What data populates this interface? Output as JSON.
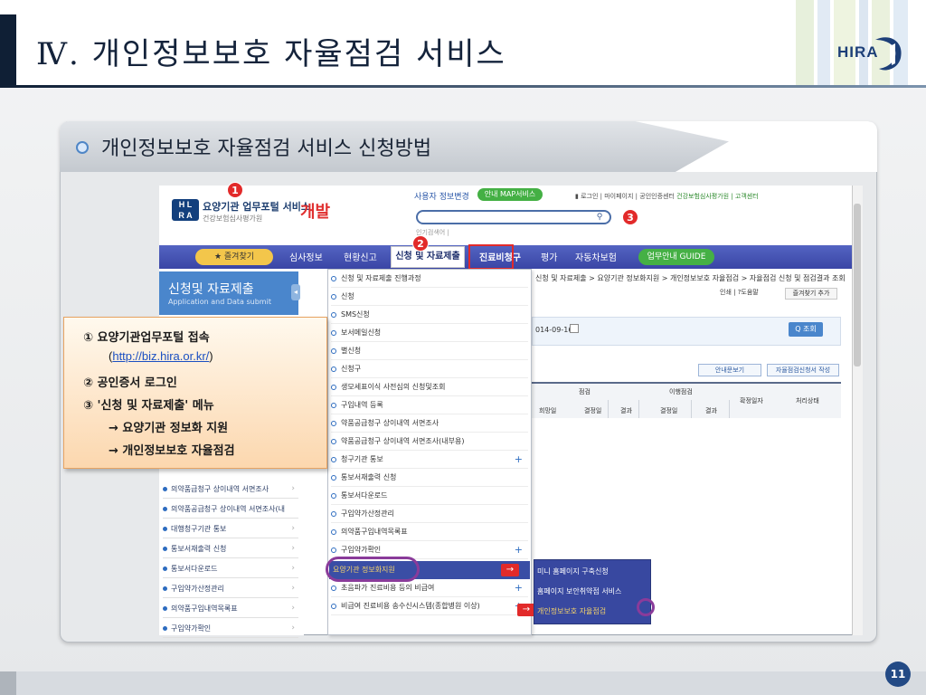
{
  "slide": {
    "title": "Ⅳ.  개인정보보호 자율점검 서비스",
    "logo_text": "HIRA",
    "section_title": "개인정보보호 자율점검 서비스 신청방법",
    "page_number": "11"
  },
  "portal": {
    "brand_box": "H L\nR A",
    "brand_title": "요양기관 업무포털 서비스",
    "brand_sub": "건강보험심사평가원",
    "dev_label": "개발",
    "user_info_btn": "사용자 정보변경",
    "map_btn": "안내 MAP서비스",
    "top_links": [
      "로그인",
      "마이페이지",
      "공인인증센터"
    ],
    "top_links_green": "건강보험심사평가원 | 고객센터",
    "search_suggest": "인기검색어 |",
    "badges": [
      "1",
      "2",
      "3"
    ],
    "nav": {
      "favorites": "★ 즐겨찾기",
      "items": [
        "심사정보",
        "현황신고",
        "신청 및 자료제출",
        "진료비청구",
        "평가",
        "자동차보험"
      ],
      "guide": "업무안내 GUIDE"
    },
    "left_panel": {
      "title": "신청및 자료제출",
      "subtitle": "Application and Data submit",
      "items": [
        "의약품급청구 상이내역 서면조사",
        "의약품공급청구 상이내역 서면조사(내",
        "대행청구기관 통보",
        "통보서재출력 신청",
        "통보서다운로드",
        "구입약가산정관리",
        "의약품구입내역목록표",
        "구입약가확인"
      ]
    },
    "dropdown": {
      "items": [
        "신청 및 자료제출 진행과정",
        "신청",
        "SMS신청",
        "보서메일신청",
        "별신청",
        "신청구",
        "생모세표이식 사전심의 신청및조회",
        "구입내역 등록",
        "약품공급청구 상이내역 서면조사",
        "약품공급청구 상이내역 서면조사(내부용)",
        "청구기관 통보",
        "통보서재출력 신청",
        "통보서다운로드",
        "구입약가산정관리",
        "의약품구입내역목록표",
        "구입약가확인"
      ],
      "selected": "요양기관 정보화지원",
      "after": [
        "초음파가 진료비용 등의 비급여",
        "비급여 진료비용 송수신시스템(종합병원 이상)"
      ]
    },
    "submenu": {
      "items": [
        "미니 홈페이지 구축신청",
        "홈페이지 보안취약점 서비스",
        "개인정보보호 자율점검"
      ]
    },
    "breadcrumb": "신청 및 자료제출 > 요양기관 정보화지원 > 개인정보보호 자율점검 > 자율점검 신청 및 점검결과 조회",
    "tools": "인쇄 | ?도움말",
    "add_favorite": "즐겨찾기 추가",
    "date": "014-09-16",
    "query_btn": "Q 조회",
    "guide_btn": "안내문보기",
    "apply_btn": "자율점검신청서 작성",
    "table": {
      "groups": [
        "점검",
        "이행점검",
        "확정일자",
        "처리상태"
      ],
      "subcols": [
        "희망일",
        "결정일",
        "결과",
        "결정일",
        "결과"
      ]
    }
  },
  "callout": {
    "line1": "① 요양기관업무포털 접속",
    "url_open": "(",
    "url": "http://biz.hira.or.kr/",
    "url_close": ")",
    "line2": "② 공인증서 로그인",
    "line3": "③ '신청 및 자료제출' 메뉴",
    "line4": "→ 요양기관 정보화 지원",
    "line5": "→ 개인정보보호 자율점검"
  },
  "arrow_glyph": "→",
  "colors": {
    "nav_blue": "#3a45a5",
    "badge_red": "#e22a2a",
    "title_dark": "#0f1f35",
    "callout_orange": "#fcd7ae"
  }
}
